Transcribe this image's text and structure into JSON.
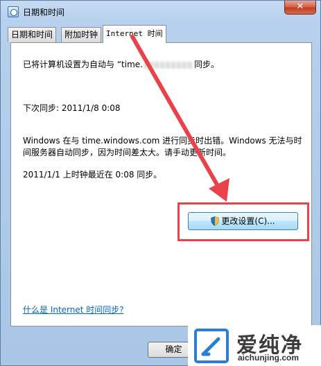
{
  "window": {
    "title": "日期和时间",
    "close_label": "✕"
  },
  "tabs": [
    {
      "label": "日期和时间",
      "active": false
    },
    {
      "label": "附加时钟",
      "active": false
    },
    {
      "label": "Internet 时间",
      "active": true
    }
  ],
  "panel": {
    "sync_line_prefix": "已将计算机设置为自动与 “time.",
    "sync_line_suffix": "同步。",
    "next_sync": "下次同步: 2011/1/8 0:08",
    "error_line_1": "Windows 在与 time.windows.com 进行同步时出错。Windows 无法与时",
    "error_line_2": "间服务器自动同步，因为时间差太大。请手动更新时间。",
    "last_sync": "2011/1/1 上时钟最近在 0:08 同步。",
    "change_settings_label": "更改设置(C)...",
    "help_link": "什么是 Internet 时间同步?"
  },
  "footer": {
    "ok_label": "确定"
  },
  "watermark": {
    "brand_cn": "爱纯净",
    "brand_url": "aichunjing.com"
  },
  "colors": {
    "highlight_red": "#e8434b",
    "link_blue": "#0066cc"
  }
}
